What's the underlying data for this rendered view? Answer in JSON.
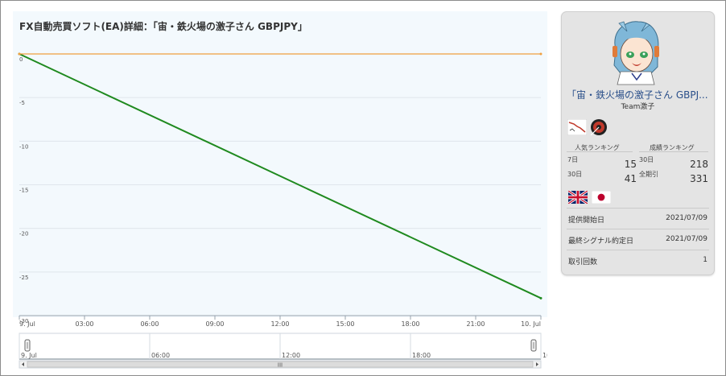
{
  "chart_title": "FX自動売買ソフト(EA)詳細：「宙・鉄火場の激子さん GBPJPY」",
  "chart_data": {
    "type": "line",
    "title": "FX自動売買ソフト(EA)詳細：「宙・鉄火場の激子さん GBPJPY」",
    "y_ticks": [
      "0",
      "-5",
      "-10",
      "-15",
      "-20",
      "-25",
      "-30"
    ],
    "x_ticks": [
      "9. Jul",
      "03:00",
      "06:00",
      "09:00",
      "12:00",
      "15:00",
      "18:00",
      "21:00",
      "10. Jul"
    ],
    "ylim": [
      -30,
      0
    ],
    "xlim_hours": [
      0,
      24
    ],
    "grid": true,
    "series": [
      {
        "color": "#1f8a1f",
        "x_hours": [
          0,
          24
        ],
        "values": [
          0,
          -28
        ]
      },
      {
        "color": "#f0a040",
        "x_hours": [
          0,
          24
        ],
        "values": [
          0,
          0
        ]
      }
    ],
    "navigator_ticks": [
      "9. Jul",
      "06:00",
      "12:00",
      "18:00",
      "10."
    ],
    "scrollbar_label": "III"
  },
  "panel": {
    "ea_name": "「宙・鉄火場の激子さん GBPJ...",
    "team": "Team激子",
    "popularity_heading": "人気ランキング",
    "performance_heading": "成績ランキング",
    "rankings": [
      {
        "label": "7日",
        "value": "15"
      },
      {
        "label": "30日",
        "value": "218"
      },
      {
        "label": "30日",
        "value": "41"
      },
      {
        "label": "全期引",
        "value": "331"
      }
    ],
    "flags": [
      "uk-flag-icon",
      "japan-flag-icon"
    ],
    "info": [
      {
        "key": "提供開始日",
        "value": "2021/07/09"
      },
      {
        "key": "最終シグナル約定日",
        "value": "2021/07/09"
      },
      {
        "key": "取引回数",
        "value": "1"
      }
    ]
  }
}
